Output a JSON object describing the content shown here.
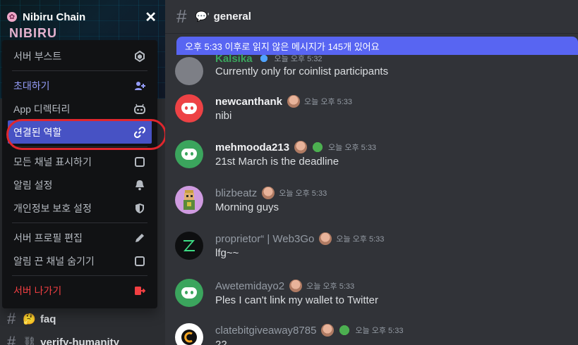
{
  "server": {
    "name": "Nibiru Chain",
    "logo_text": "NIBIRU"
  },
  "menu": {
    "items": [
      {
        "label": "서버 부스트",
        "icon": "boost-icon"
      },
      {
        "label": "초대하기",
        "icon": "invite-icon"
      },
      {
        "label": "App 디렉터리",
        "icon": "bot-icon"
      },
      {
        "label": "연결된 역할",
        "icon": "link-icon"
      },
      {
        "label": "모든 채널 표시하기",
        "icon": "checkbox-icon"
      },
      {
        "label": "알림 설정",
        "icon": "bell-icon"
      },
      {
        "label": "개인정보 보호 설정",
        "icon": "shield-icon"
      },
      {
        "label": "서버 프로필 편집",
        "icon": "pencil-icon"
      },
      {
        "label": "알림 끈 채널 숨기기",
        "icon": "checkbox-icon"
      },
      {
        "label": "서버 나가기",
        "icon": "leave-icon"
      }
    ]
  },
  "channels": [
    {
      "emoji": "🤔",
      "name": "faq"
    },
    {
      "emoji": "⛓",
      "name": "verify-humanity"
    }
  ],
  "header": {
    "channel_name": "general"
  },
  "unread_banner": "오후 5:33 이후로 읽지 않은 메시지가 145개 있어요",
  "messages": [
    {
      "user": "Kalsika",
      "time": "오늘 오후 5:32",
      "text": "Currently only for coinlist participants"
    },
    {
      "user": "newcanthank",
      "time": "오늘 오후 5:33",
      "text": "nibi"
    },
    {
      "user": "mehmooda213",
      "time": "오늘 오후 5:33",
      "text": "21st March is the deadline"
    },
    {
      "user": "blizbeatz",
      "time": "오늘 오후 5:33",
      "text": "Morning guys"
    },
    {
      "user": "proprietor“ | Web3Go",
      "time": "오늘 오후 5:33",
      "text": "lfg~~"
    },
    {
      "user": "Awetemidayo2",
      "time": "오늘 오후 5:33",
      "text": "Ples I can't link my wallet to Twitter"
    },
    {
      "user": "clatebitgiveaway8785",
      "time": "오늘 오후 5:33",
      "text": "22"
    }
  ],
  "colors": {
    "accent": "#5865f2",
    "active_menu": "#4752c4",
    "danger": "#f23f42",
    "highlight_ring": "#e0262d"
  }
}
